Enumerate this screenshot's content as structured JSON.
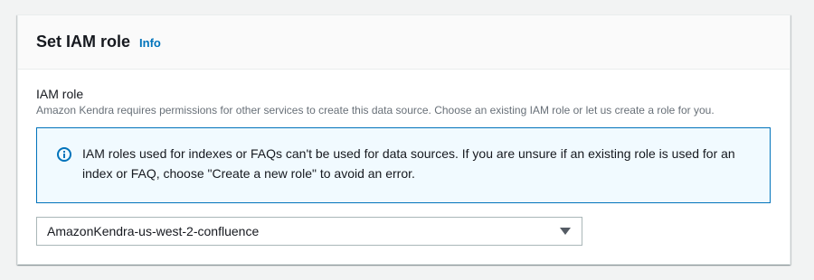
{
  "section": {
    "title": "Set IAM role",
    "info_label": "Info"
  },
  "field": {
    "label": "IAM role",
    "description": "Amazon Kendra requires permissions for other services to create this data source. Choose an existing IAM role or let us create a role for you."
  },
  "alert": {
    "icon": "info-icon",
    "text": "IAM roles used for indexes or FAQs can't be used for data sources. If you are unsure if an existing role is used for an index or FAQ, choose \"Create a new role\" to avoid an error."
  },
  "select": {
    "value": "AmazonKendra-us-west-2-confluence",
    "icon": "caret-down-icon"
  },
  "colors": {
    "link": "#0073bb",
    "alert_border": "#0073bb",
    "alert_background": "#f1faff",
    "page_background": "#f2f3f3"
  }
}
